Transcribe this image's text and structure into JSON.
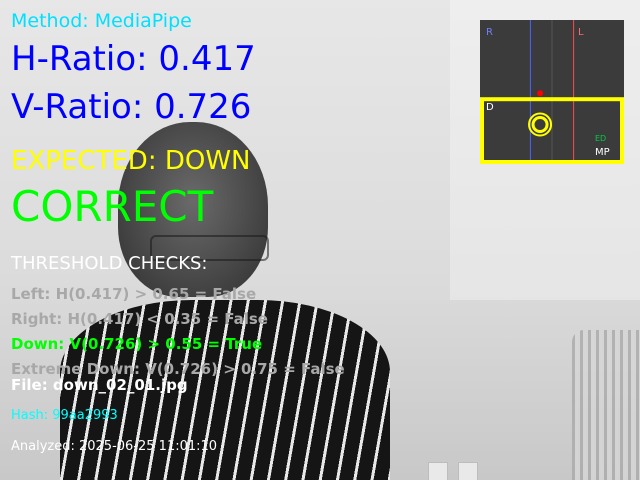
{
  "overlay": {
    "method": "Method: MediaPipe",
    "h_ratio": "H-Ratio: 0.417",
    "v_ratio": "V-Ratio: 0.726",
    "expected": "EXPECTED: DOWN",
    "verdict": "CORRECT",
    "checks_heading": "THRESHOLD CHECKS:",
    "checks": [
      {
        "text": "Left: H(0.417) > 0.65 = False",
        "passed": false
      },
      {
        "text": "Right: H(0.417) < 0.35 = False",
        "passed": false
      },
      {
        "text": "Down: V(0.726) > 0.55 = True",
        "passed": true
      },
      {
        "text": "Extreme Down: V(0.726) > 0.75 = False",
        "passed": false
      }
    ],
    "file": "File: down_02_01.jpg",
    "hash": "Hash: 99aa2993",
    "analyzed": "Analyzed: 2025-06-25 11:01:10"
  },
  "gaze_panel": {
    "zone_labels": {
      "right": "R",
      "left": "L",
      "down": "D",
      "extreme_down": "ED",
      "method": "MP"
    },
    "gaze_point": {
      "h": 0.417,
      "v": 0.726
    },
    "thresholds": {
      "left": 0.65,
      "right": 0.35,
      "down": 0.55,
      "extreme_down": 0.75
    },
    "colors": {
      "panel": "#3b3b3b",
      "down_zone_border": "#ffff00",
      "gaze_marker": "#ffff00",
      "top_marker": "#ff0000",
      "right_line": "#4b63ff",
      "left_line": "#ff4b4b",
      "extreme_label": "#00cc44",
      "method_label": "#ffffff"
    }
  }
}
